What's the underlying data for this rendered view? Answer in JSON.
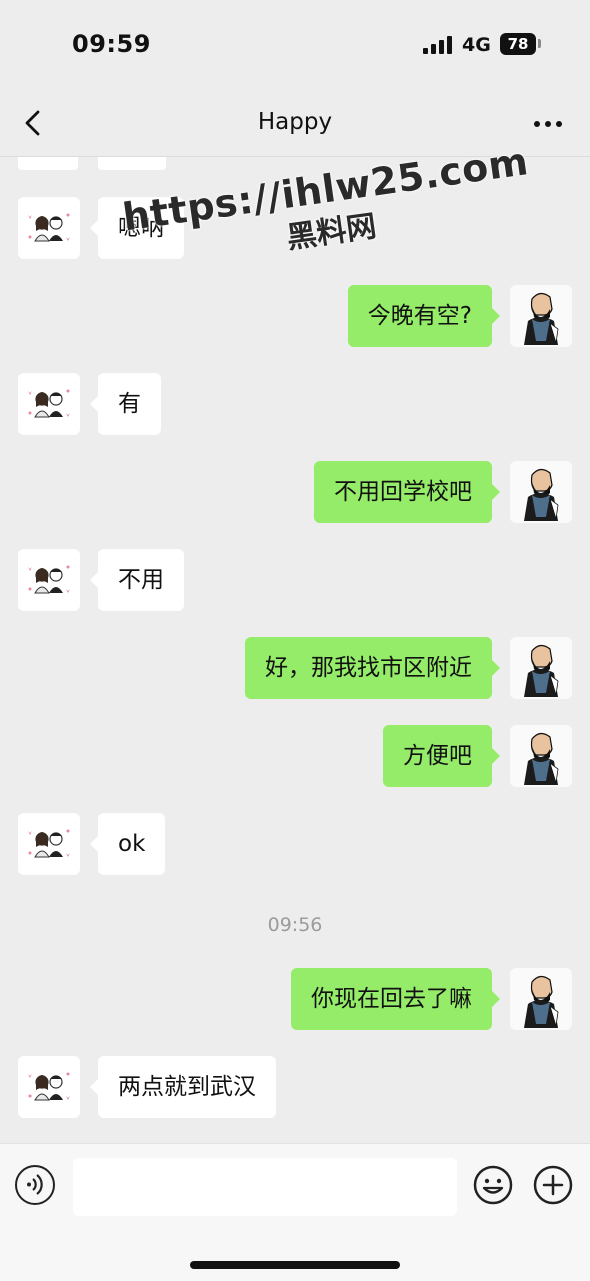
{
  "status_bar": {
    "time": "09:59",
    "network": "4G",
    "battery": "78"
  },
  "nav": {
    "title": "Happy"
  },
  "watermark": {
    "url": "https://ihlw25.com",
    "subtitle": "黑料网"
  },
  "messages": [
    {
      "side": "in",
      "text": "嗯呐"
    },
    {
      "side": "out",
      "text": "今晚有空?"
    },
    {
      "side": "in",
      "text": "有"
    },
    {
      "side": "out",
      "text": "不用回学校吧"
    },
    {
      "side": "in",
      "text": "不用"
    },
    {
      "side": "out",
      "text": "好，那我找市区附近"
    },
    {
      "side": "out",
      "text": "方便吧"
    },
    {
      "side": "in",
      "text": "ok"
    },
    {
      "side": "time",
      "text": "09:56"
    },
    {
      "side": "out",
      "text": "你现在回去了嘛"
    },
    {
      "side": "in",
      "text": "两点就到武汉"
    }
  ],
  "icons": {
    "back": "chevron-left-icon",
    "more": "more-dots-icon",
    "voice": "voice-icon",
    "emoji": "emoji-icon",
    "plus": "plus-icon"
  },
  "colors": {
    "background": "#ededed",
    "outgoing_bubble": "#95ec69",
    "incoming_bubble": "#ffffff",
    "timestamp": "#9b9b9b"
  }
}
